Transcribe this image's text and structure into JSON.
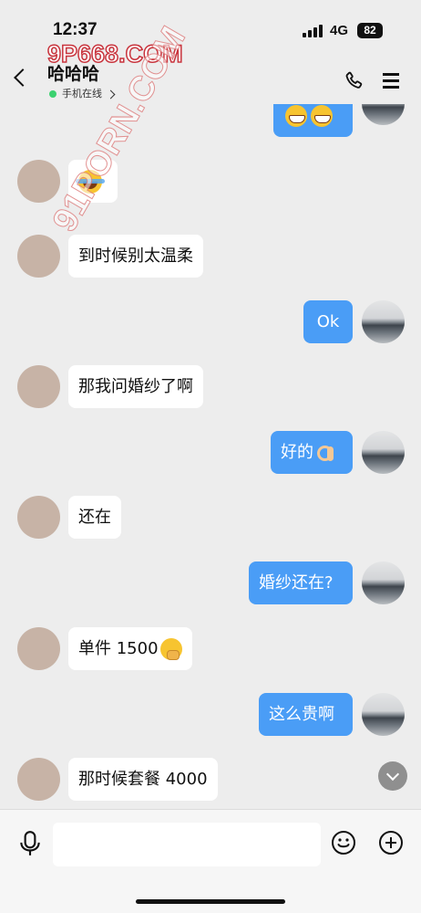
{
  "status_bar": {
    "time": "12:37",
    "network": "4G",
    "battery": "82"
  },
  "watermarks": {
    "top": "9P668.COM",
    "diagonal": "91PORN.COM"
  },
  "header": {
    "contact_name": "哈哈哈",
    "status": "手机在线"
  },
  "messages": [
    {
      "side": "out",
      "emoji": [
        "grin-icon",
        "grin-icon"
      ]
    },
    {
      "side": "in",
      "emoji": [
        "laugh-cry-icon"
      ]
    },
    {
      "side": "in",
      "text": "到时候别太温柔"
    },
    {
      "side": "out",
      "text": "Ok"
    },
    {
      "side": "in",
      "text": "那我问婚纱了啊"
    },
    {
      "side": "out",
      "text": "好的",
      "emoji": [
        "ok-hand-icon"
      ]
    },
    {
      "side": "in",
      "text": "还在"
    },
    {
      "side": "out",
      "text": "婚纱还在?"
    },
    {
      "side": "in",
      "text": "单件 1500",
      "emoji": [
        "shush-icon"
      ]
    },
    {
      "side": "out",
      "text": "这么贵啊"
    },
    {
      "side": "in",
      "text": "那时候套餐 4000"
    }
  ],
  "input": {
    "placeholder": "",
    "value": ""
  },
  "colors": {
    "outgoing_bubble": "#4a9df6",
    "incoming_bubble": "#ffffff",
    "background": "#ededed",
    "online_dot": "#3bd16f",
    "watermark_red": "#c8343d"
  }
}
